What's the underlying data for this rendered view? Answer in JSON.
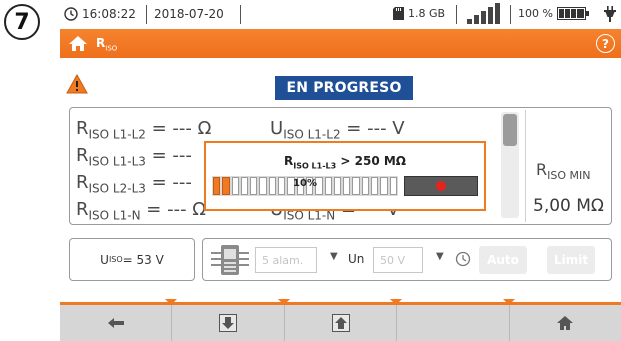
{
  "step_number": "7",
  "status_bar": {
    "time": "16:08:22",
    "date": "2018-07-20",
    "storage": "1.8 GB",
    "battery_percent": "100 %",
    "signal_level": 1.0,
    "battery_level": 1.0
  },
  "header": {
    "title_main": "R",
    "title_sub": "ISO"
  },
  "banner": "EN PROGRESO",
  "results": {
    "rows": [
      {
        "r_main": "R",
        "r_sub": "ISO L1-L2",
        "r_val": " = --- Ω",
        "u_main": "U",
        "u_sub": "ISO L1-L2",
        "u_val": " = --- V"
      },
      {
        "r_main": "R",
        "r_sub": "ISO L1-L3",
        "r_val": " = ---"
      },
      {
        "r_main": "R",
        "r_sub": "ISO L2-L3",
        "r_val": " = ---"
      },
      {
        "r_main": "R",
        "r_sub": "ISO L1-N",
        "r_val": " = --- Ω",
        "u_main": "U",
        "u_sub": "ISO L1-N",
        "u_val": " = --- V"
      }
    ],
    "rmin_main": "R",
    "rmin_sub": "ISO MIN",
    "rmin_value": "5,00 MΩ"
  },
  "popup": {
    "title_main": "R",
    "title_sub": "ISO L1-L3",
    "title_rest": " > 250 MΩ",
    "progress_label": "10%",
    "progress": 0.1
  },
  "params": {
    "uiso_main": "U",
    "uiso_sub": "ISO",
    "uiso_value": " = 53 V",
    "alarm_value": "5 alam.",
    "un_label": "Un",
    "un_value": "50 V",
    "auto_label": "Auto",
    "limit_label": "Limit"
  },
  "colors": {
    "accent": "#f07a22",
    "banner": "#1f4f96",
    "stop": "#e8221c"
  },
  "icons": [
    "clock-icon",
    "sd-card-icon",
    "signal-bars-icon",
    "battery-icon",
    "power-plug-icon",
    "home-icon",
    "help-icon",
    "warning-icon",
    "stop-icon",
    "meter-icon",
    "timer-icon",
    "arrow-left-icon",
    "page-down-icon",
    "page-up-icon"
  ]
}
